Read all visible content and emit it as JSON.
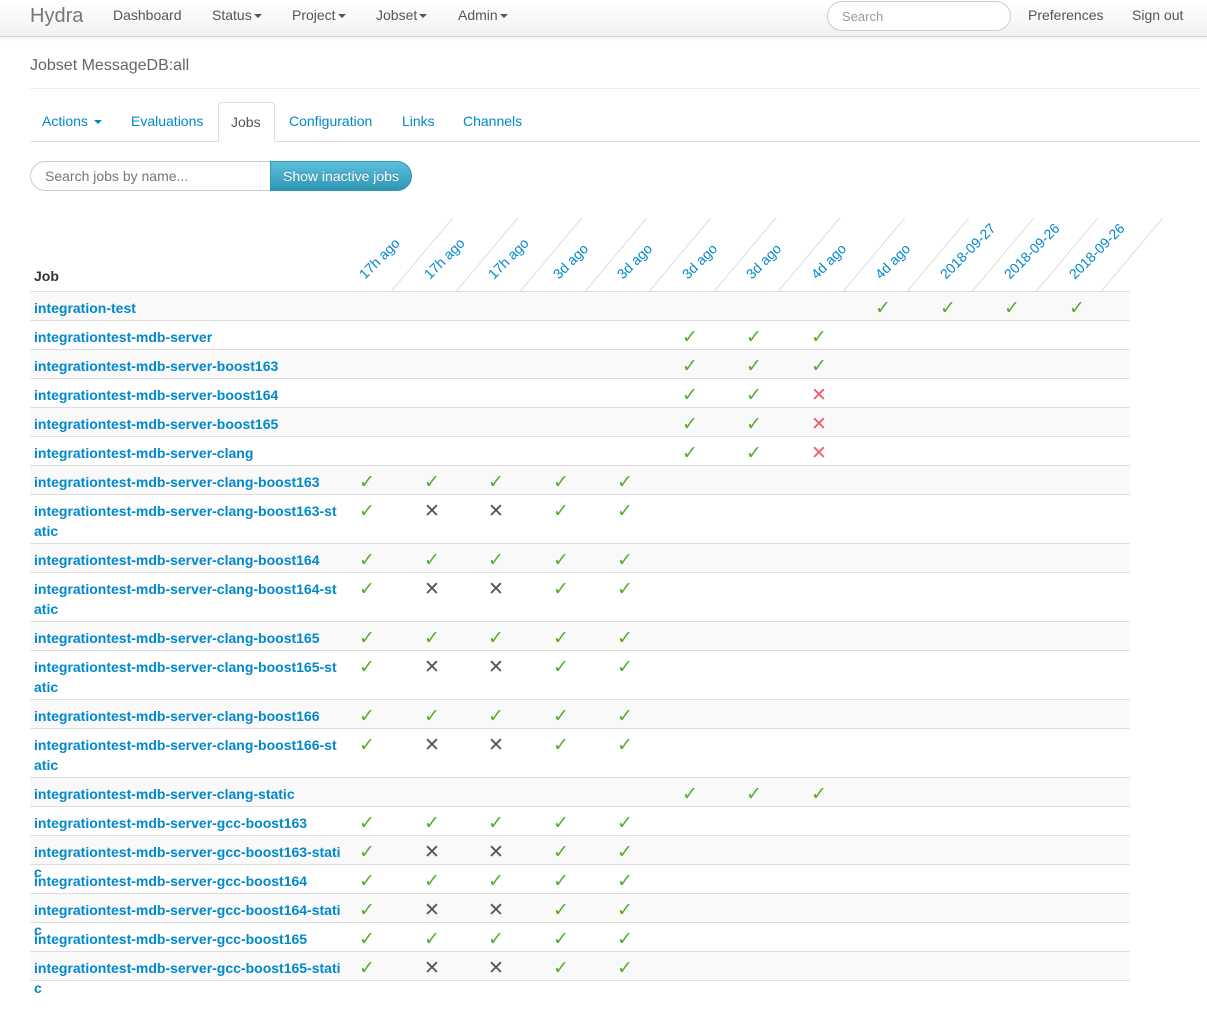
{
  "navbar": {
    "brand": "Hydra",
    "items": [
      {
        "label": "Dashboard",
        "dropdown": false
      },
      {
        "label": "Status",
        "dropdown": true
      },
      {
        "label": "Project",
        "dropdown": true
      },
      {
        "label": "Jobset",
        "dropdown": true
      },
      {
        "label": "Admin",
        "dropdown": true
      }
    ],
    "search_placeholder": "Search",
    "preferences": "Preferences",
    "signout": "Sign out"
  },
  "page": {
    "title": "Jobset MessageDB:all"
  },
  "tabs": [
    {
      "label": "Actions",
      "dropdown": true,
      "active": false
    },
    {
      "label": "Evaluations",
      "dropdown": false,
      "active": false
    },
    {
      "label": "Jobs",
      "dropdown": false,
      "active": true
    },
    {
      "label": "Configuration",
      "dropdown": false,
      "active": false
    },
    {
      "label": "Links",
      "dropdown": false,
      "active": false
    },
    {
      "label": "Channels",
      "dropdown": false,
      "active": false
    }
  ],
  "filter": {
    "placeholder": "Search jobs by name...",
    "button": "Show inactive jobs"
  },
  "table": {
    "job_header": "Job",
    "columns": [
      "17h ago",
      "17h ago",
      "17h ago",
      "3d ago",
      "3d ago",
      "3d ago",
      "3d ago",
      "4d ago",
      "4d ago",
      "2018-09-27",
      "2018-09-26",
      "2018-09-26"
    ],
    "status_legend": {
      "s": "succeeded",
      "a": "aborted",
      "f": "failed",
      "": "none"
    },
    "icons": {
      "s": "check-icon",
      "a": "cross-icon",
      "f": "red-cross-icon"
    },
    "colors": {
      "s": "#5aab2e",
      "a": "#555555",
      "f": "#ee5f6e",
      "link": "#0088cc"
    },
    "rows": [
      {
        "name": "integration-test",
        "status": [
          "",
          "",
          "",
          "",
          "",
          "",
          "",
          "",
          "s",
          "s",
          "s",
          "s"
        ]
      },
      {
        "name": "integrationtest-mdb-server",
        "status": [
          "",
          "",
          "",
          "",
          "",
          "s",
          "s",
          "s",
          "",
          "",
          "",
          ""
        ]
      },
      {
        "name": "integrationtest-mdb-server-boost163",
        "status": [
          "",
          "",
          "",
          "",
          "",
          "s",
          "s",
          "s",
          "",
          "",
          "",
          ""
        ]
      },
      {
        "name": "integrationtest-mdb-server-boost164",
        "status": [
          "",
          "",
          "",
          "",
          "",
          "s",
          "s",
          "f",
          "",
          "",
          "",
          ""
        ]
      },
      {
        "name": "integrationtest-mdb-server-boost165",
        "status": [
          "",
          "",
          "",
          "",
          "",
          "s",
          "s",
          "f",
          "",
          "",
          "",
          ""
        ]
      },
      {
        "name": "integrationtest-mdb-server-clang",
        "status": [
          "",
          "",
          "",
          "",
          "",
          "s",
          "s",
          "f",
          "",
          "",
          "",
          ""
        ]
      },
      {
        "name": "integrationtest-mdb-server-clang-boost163",
        "status": [
          "s",
          "s",
          "s",
          "s",
          "s",
          "",
          "",
          "",
          "",
          "",
          "",
          ""
        ]
      },
      {
        "name": "integrationtest-mdb-server-clang-boost163-static",
        "status": [
          "s",
          "a",
          "a",
          "s",
          "s",
          "",
          "",
          "",
          "",
          "",
          "",
          ""
        ]
      },
      {
        "name": "integrationtest-mdb-server-clang-boost164",
        "status": [
          "s",
          "s",
          "s",
          "s",
          "s",
          "",
          "",
          "",
          "",
          "",
          "",
          ""
        ]
      },
      {
        "name": "integrationtest-mdb-server-clang-boost164-static",
        "status": [
          "s",
          "a",
          "a",
          "s",
          "s",
          "",
          "",
          "",
          "",
          "",
          "",
          ""
        ]
      },
      {
        "name": "integrationtest-mdb-server-clang-boost165",
        "status": [
          "s",
          "s",
          "s",
          "s",
          "s",
          "",
          "",
          "",
          "",
          "",
          "",
          ""
        ]
      },
      {
        "name": "integrationtest-mdb-server-clang-boost165-static",
        "status": [
          "s",
          "a",
          "a",
          "s",
          "s",
          "",
          "",
          "",
          "",
          "",
          "",
          ""
        ]
      },
      {
        "name": "integrationtest-mdb-server-clang-boost166",
        "status": [
          "s",
          "s",
          "s",
          "s",
          "s",
          "",
          "",
          "",
          "",
          "",
          "",
          ""
        ]
      },
      {
        "name": "integrationtest-mdb-server-clang-boost166-static",
        "status": [
          "s",
          "a",
          "a",
          "s",
          "s",
          "",
          "",
          "",
          "",
          "",
          "",
          ""
        ]
      },
      {
        "name": "integrationtest-mdb-server-clang-static",
        "status": [
          "",
          "",
          "",
          "",
          "",
          "s",
          "s",
          "s",
          "",
          "",
          "",
          ""
        ]
      },
      {
        "name": "integrationtest-mdb-server-gcc-boost163",
        "status": [
          "s",
          "s",
          "s",
          "s",
          "s",
          "",
          "",
          "",
          "",
          "",
          "",
          ""
        ]
      },
      {
        "name": "integrationtest-mdb-server-gcc-boost163-static",
        "status": [
          "s",
          "a",
          "a",
          "s",
          "s",
          "",
          "",
          "",
          "",
          "",
          "",
          ""
        ]
      },
      {
        "name": "integrationtest-mdb-server-gcc-boost164",
        "status": [
          "s",
          "s",
          "s",
          "s",
          "s",
          "",
          "",
          "",
          "",
          "",
          "",
          ""
        ]
      },
      {
        "name": "integrationtest-mdb-server-gcc-boost164-static",
        "status": [
          "s",
          "a",
          "a",
          "s",
          "s",
          "",
          "",
          "",
          "",
          "",
          "",
          ""
        ]
      },
      {
        "name": "integrationtest-mdb-server-gcc-boost165",
        "status": [
          "s",
          "s",
          "s",
          "s",
          "s",
          "",
          "",
          "",
          "",
          "",
          "",
          ""
        ]
      },
      {
        "name": "integrationtest-mdb-server-gcc-boost165-static",
        "status": [
          "s",
          "a",
          "a",
          "s",
          "s",
          "",
          "",
          "",
          "",
          "",
          "",
          ""
        ]
      }
    ]
  }
}
